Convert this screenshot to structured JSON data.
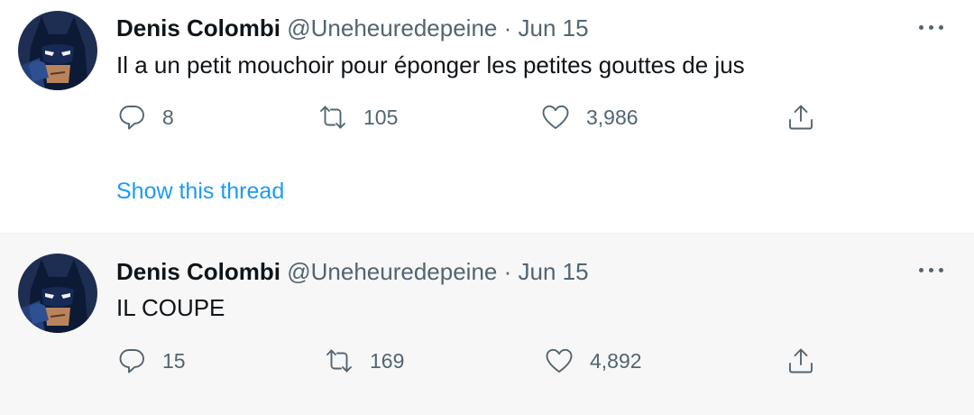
{
  "tweets": [
    {
      "author_name": "Denis Colombi",
      "handle": "@Uneheuredepeine",
      "separator": "·",
      "date": "Jun 15",
      "text": "Il a un petit mouchoir pour éponger les petites gouttes de jus",
      "replies": "8",
      "retweets": "105",
      "likes": "3,986",
      "show_thread": "Show this thread"
    },
    {
      "author_name": "Denis Colombi",
      "handle": "@Uneheuredepeine",
      "separator": "·",
      "date": "Jun 15",
      "text": "IL COUPE",
      "replies": "15",
      "retweets": "169",
      "likes": "4,892"
    }
  ],
  "icons": {
    "more": "more-horizontal-icon",
    "reply": "reply-icon",
    "retweet": "retweet-icon",
    "like": "heart-icon",
    "share": "share-icon"
  },
  "colors": {
    "link_blue": "#1d9bf0",
    "secondary_text": "#536471",
    "highlight_bg": "#f7f7f7"
  }
}
